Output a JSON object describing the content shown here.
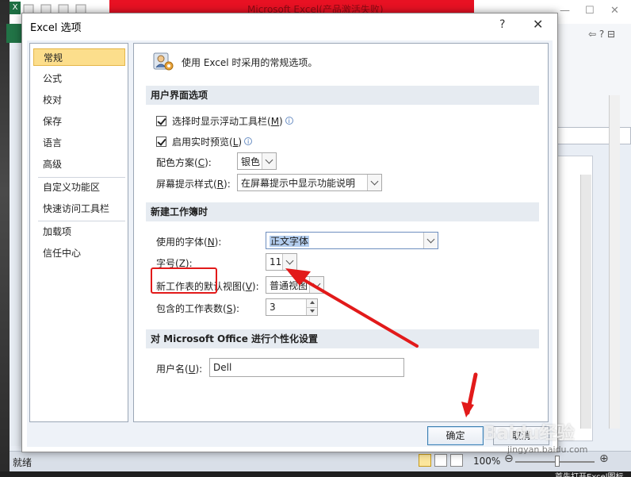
{
  "background_window": {
    "title": "Microsoft Excel(产品激活失败)",
    "status": "就绪",
    "zoom": "100%",
    "caption": "首先打开Excel图标"
  },
  "dialog": {
    "title": "Excel 选项",
    "help_glyph": "?",
    "close_glyph": "✕",
    "nav": [
      {
        "label": "常规",
        "selected": true
      },
      {
        "label": "公式",
        "selected": false
      },
      {
        "label": "校对",
        "selected": false
      },
      {
        "label": "保存",
        "selected": false
      },
      {
        "label": "语言",
        "selected": false
      },
      {
        "label": "高级",
        "selected": false
      },
      {
        "label": "自定义功能区",
        "selected": false
      },
      {
        "label": "快速访问工具栏",
        "selected": false
      },
      {
        "label": "加载项",
        "selected": false
      },
      {
        "label": "信任中心",
        "selected": false
      }
    ],
    "intro": "使用 Excel 时采用的常规选项。",
    "sections": {
      "ui": "用户界面选项",
      "workbook": "新建工作簿时",
      "personal": "对 Microsoft Office 进行个性化设置"
    },
    "ui_options": {
      "mini_toolbar": {
        "text": "选择时显示浮动工具栏(",
        "key": "M",
        "close": ")",
        "checked": true
      },
      "live_preview": {
        "text": "启用实时预览(",
        "key": "L",
        "close": ")",
        "checked": true
      },
      "color_scheme": {
        "text": "配色方案(",
        "key": "C",
        "close": "):",
        "value": "银色"
      },
      "screentip": {
        "text": "屏幕提示样式(",
        "key": "R",
        "close": "):",
        "value": "在屏幕提示中显示功能说明"
      }
    },
    "workbook_options": {
      "font": {
        "text": "使用的字体(",
        "key": "N",
        "close": "):",
        "value": "正文字体"
      },
      "font_size": {
        "text": "字号(",
        "key": "Z",
        "close": "):",
        "value": "11"
      },
      "default_view": {
        "text": "新工作表的默认视图(",
        "key": "V",
        "close": "):",
        "value": "普通视图"
      },
      "sheet_count": {
        "text": "包含的工作表数(",
        "key": "S",
        "close": "):",
        "value": "3"
      }
    },
    "personal_options": {
      "username": {
        "text": "用户名(",
        "key": "U",
        "close": "):",
        "value": "Dell"
      }
    },
    "buttons": {
      "ok": "确定",
      "cancel": "取消"
    }
  },
  "watermark": {
    "main": "Baidu经验",
    "sub": "jingyan.baidu.com"
  },
  "colors": {
    "annotation_red": "#e21a1a",
    "nav_selected": "#fcde8c",
    "excel_green": "#217346"
  }
}
